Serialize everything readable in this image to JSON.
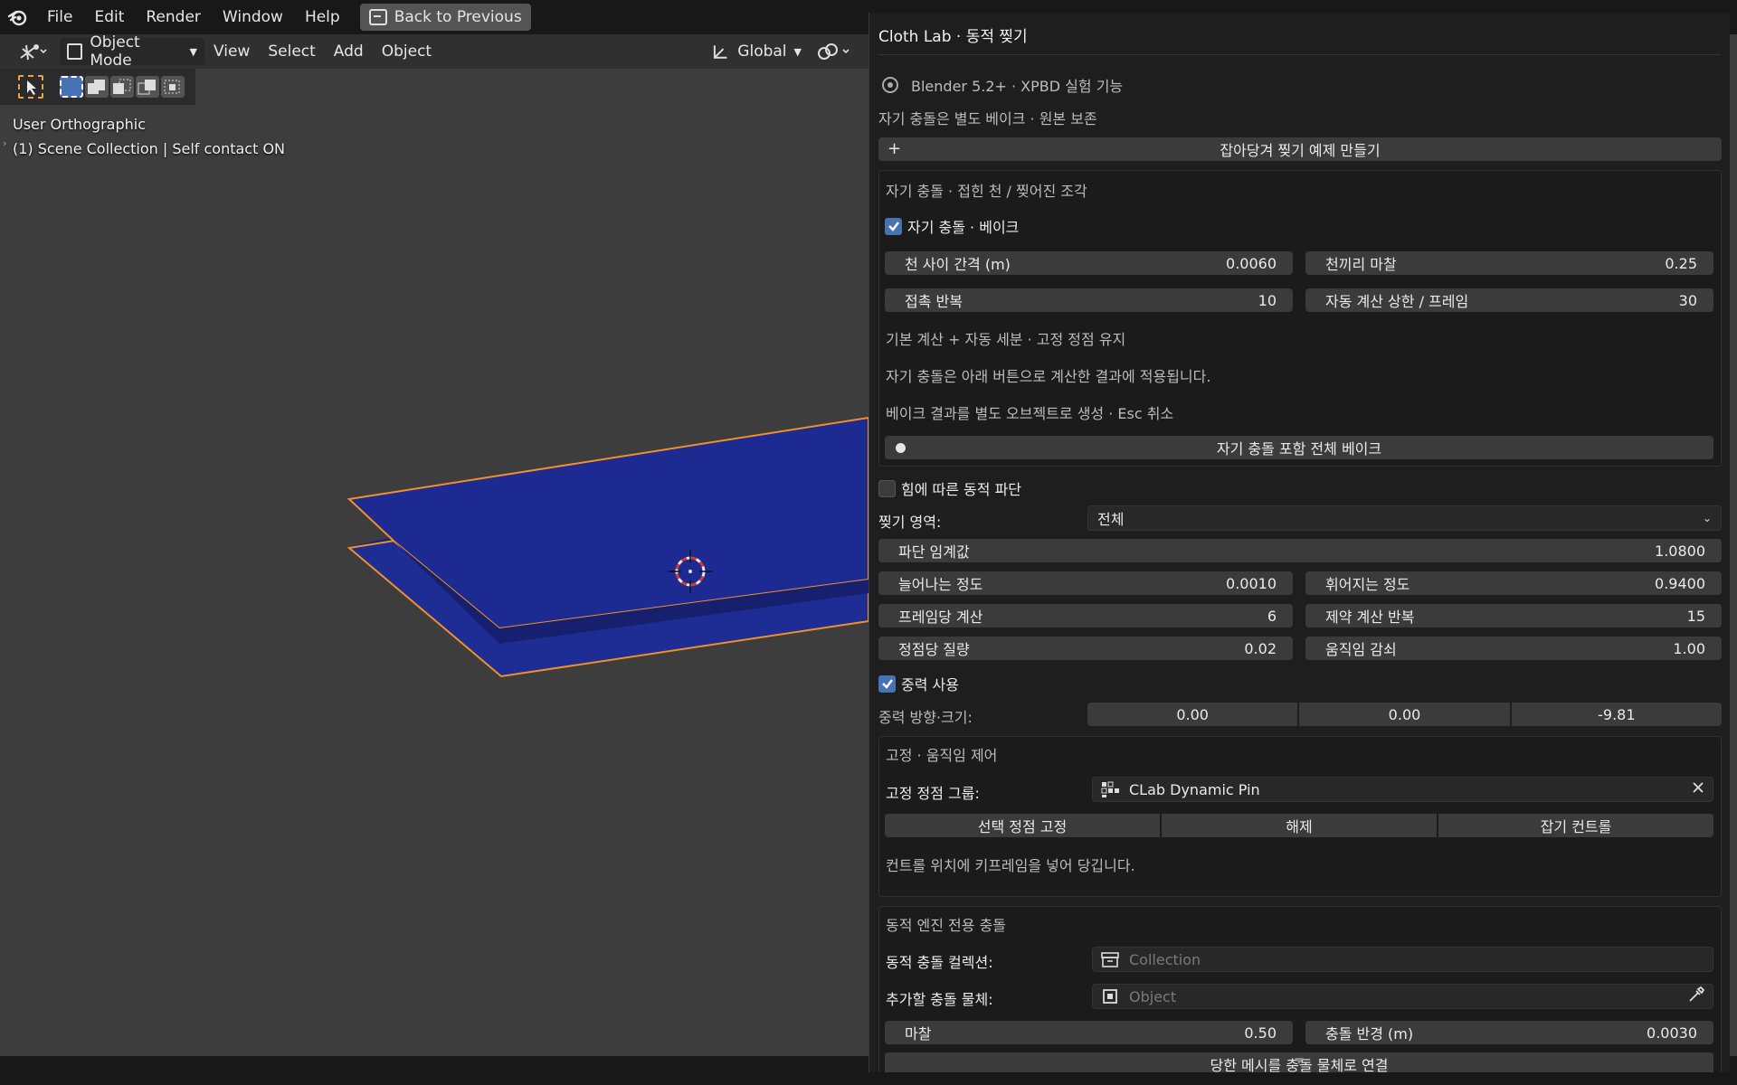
{
  "menubar": {
    "items": [
      "File",
      "Edit",
      "Render",
      "Window",
      "Help"
    ],
    "back_label": "Back to Previous"
  },
  "viewport_header": {
    "mode": "Object Mode",
    "menus": [
      "View",
      "Select",
      "Add",
      "Object"
    ],
    "orientation": "Global"
  },
  "viewport": {
    "view_name": "User Orthographic",
    "collection_info": "(1) Scene Collection | Self contact ON",
    "mesh_color": "#1a2b8f",
    "outline_color": "#f0902a"
  },
  "panel": {
    "title": "Cloth Lab · 동적 찢기",
    "version_info": "Blender 5.2+ · XPBD 실험 기능",
    "bake_note": "자기 충돌은 별도 베이크 · 원본 보존",
    "create_example_label": "잡아당겨 찢기 예제 만들기",
    "self_collision": {
      "section_title": "자기 충돌 · 접힌 천 / 찢어진 조각",
      "enable_label": "자기 충돌 · 베이크",
      "enabled": true,
      "fields": [
        {
          "label": "천 사이 간격 (m)",
          "value": "0.0060"
        },
        {
          "label": "천끼리 마찰",
          "value": "0.25"
        },
        {
          "label": "접촉 반복",
          "value": "10"
        },
        {
          "label": "자동 계산 상한 / 프레임",
          "value": "30"
        }
      ],
      "info1": "기본 계산 + 자동 세분 · 고정 정점 유지",
      "info2": "자기 충돌은 아래 버튼으로 계산한 결과에 적용됩니다.",
      "info3": "베이크 결과를 별도 오브젝트로 생성 · Esc 취소",
      "bake_label": "자기 충돌 포함 전체 베이크"
    },
    "dynamic_tear": {
      "enable_label": "힘에 따른 동적 파단",
      "enabled": false,
      "area_label": "찢기 영역:",
      "area_value": "전체",
      "threshold_label": "파단 임계값",
      "threshold_value": "1.0800",
      "fields": [
        {
          "label": "늘어나는 정도",
          "value": "0.0010"
        },
        {
          "label": "휘어지는 정도",
          "value": "0.9400"
        },
        {
          "label": "프레임당 계산",
          "value": "6"
        },
        {
          "label": "제약 계산 반복",
          "value": "15"
        },
        {
          "label": "정점당 질량",
          "value": "0.02"
        },
        {
          "label": "움직임 감쇠",
          "value": "1.00"
        }
      ],
      "gravity_label": "중력 사용",
      "gravity_enabled": true,
      "gravity_vec_label": "중력 방향·크기:",
      "gravity_vec": [
        "0.00",
        "0.00",
        "-9.81"
      ]
    },
    "pin": {
      "section_title": "고정 · 움직임 제어",
      "group_label": "고정 정점 그룹:",
      "group_value": "CLab Dynamic Pin",
      "buttons": [
        "선택 정점 고정",
        "해제",
        "잡기 컨트롤"
      ],
      "note": "컨트롤 위치에 키프레임을 넣어 당깁니다."
    },
    "collision": {
      "section_title": "동적 엔진 전용 충돌",
      "collection_label": "동적 충돌 컬렉션:",
      "collection_placeholder": "Collection",
      "object_label": "추가할 충돌 물체:",
      "object_placeholder": "Object",
      "friction_label": "마찰",
      "friction_value": "0.50",
      "radius_label": "충돌 반경 (m)",
      "radius_value": "0.0030",
      "partial_button": "당한 메시를 충돌 물체로 연결"
    }
  }
}
